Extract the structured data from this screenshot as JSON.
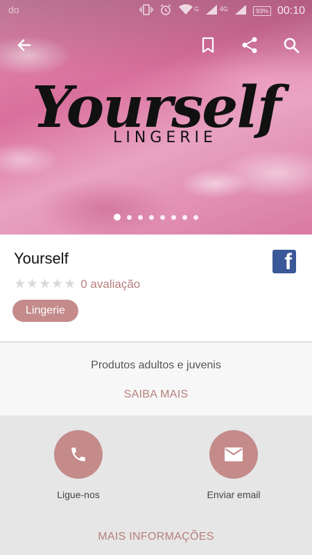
{
  "status_bar": {
    "left_text": "do",
    "network_g": "G",
    "network_4g": "4G",
    "battery": "93%",
    "time": "00:10"
  },
  "toolbar": {
    "back_icon": "arrow-left-icon",
    "bookmark_icon": "bookmark-icon",
    "share_icon": "share-icon",
    "search_icon": "search-icon"
  },
  "hero": {
    "logo_script": "Yourself",
    "logo_sub": "LINGERIE",
    "carousel_count": 8,
    "carousel_active": 1
  },
  "store": {
    "name": "Yourself",
    "rating_stars": 5,
    "rating_value": 0,
    "rating_label": "0 avaliação",
    "category": "Lingerie",
    "facebook_icon": "facebook-icon"
  },
  "description": {
    "text": "Produtos adultos e juvenis",
    "more_link": "SAIBA MAIS"
  },
  "actions": {
    "call_label": "Ligue-nos",
    "email_label": "Enviar email",
    "more_info": "MAIS INFORMAÇÕES"
  },
  "colors": {
    "accent": "#c48b8a",
    "link": "#b67e7c",
    "facebook": "#3b5998"
  }
}
